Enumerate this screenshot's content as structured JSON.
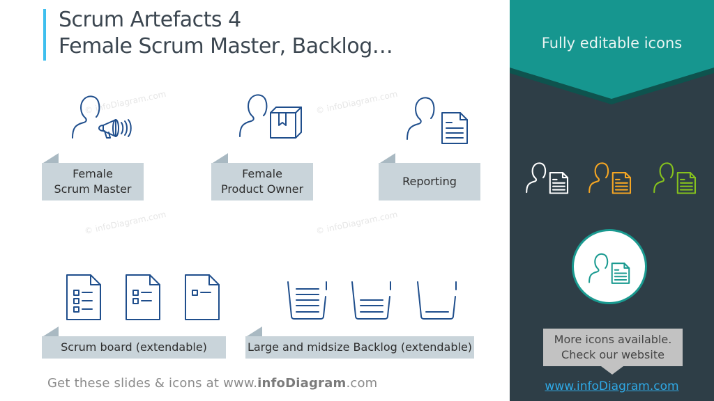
{
  "slide": {
    "title_line1": "Scrum Artefacts 4",
    "title_line2": "Female Scrum Master, Backlog…",
    "accent_color": "#3fbfee",
    "icon_color": "#1f4e8c",
    "label_bg": "#c9d4da",
    "label_flap": "#a9b9c2"
  },
  "watermark": "© infoDiagram.com",
  "items": [
    {
      "label_line1": "Female",
      "label_line2": "Scrum Master",
      "icon": "female-megaphone-icon"
    },
    {
      "label_line1": "Female",
      "label_line2": "Product Owner",
      "icon": "female-box-icon"
    },
    {
      "label_line1": "Reporting",
      "label_line2": "",
      "icon": "female-document-icon"
    },
    {
      "label_line1": "Scrum board (extendable)",
      "icon": "checklist-document-icon"
    },
    {
      "label_line1": "Large and midsize Backlog (extendable)",
      "icon": "backlog-bucket-icon"
    }
  ],
  "footer": {
    "prefix": "Get these slides & icons at www.",
    "brand": "infoDiagram",
    "suffix": ".com"
  },
  "sidebar": {
    "heading": "Fully editable icons",
    "teal": "#16968f",
    "teal_dark": "#0e534e",
    "bg": "#2e3e47",
    "variant_colors": [
      "#ffffff",
      "#f5a623",
      "#86c21d"
    ],
    "callout_line1": "More icons available.",
    "callout_line2": "Check our website",
    "link": "www.infoDiagram.com"
  }
}
